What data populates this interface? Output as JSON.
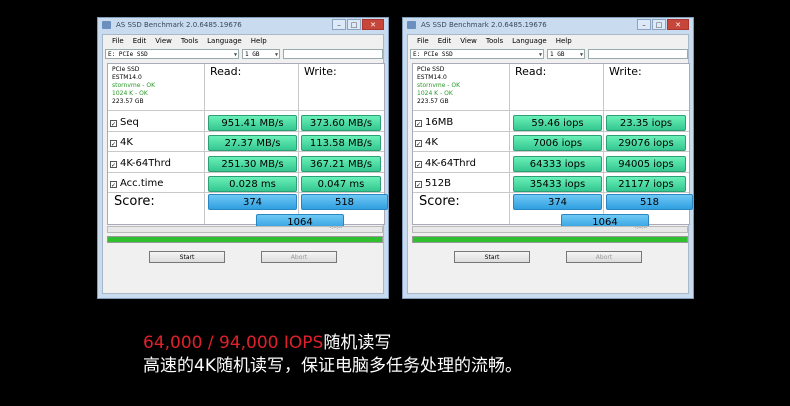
{
  "windows": [
    {
      "title": "AS SSD Benchmark 2.0.6485.19676",
      "menu": [
        "File",
        "Edit",
        "View",
        "Tools",
        "Language",
        "Help"
      ],
      "drive_select": "E: PCIe SSD",
      "size_select": "1 GB",
      "drive_info": {
        "name": "PCIe SSD",
        "firmware": "ESTM14.0",
        "driver": "stornvme - OK",
        "alignment": "1024 K - OK",
        "capacity": "223.57 GB"
      },
      "read_header": "Read:",
      "write_header": "Write:",
      "rows": [
        {
          "label": "Seq",
          "read": "951.41 MB/s",
          "write": "373.60 MB/s"
        },
        {
          "label": "4K",
          "read": "27.37 MB/s",
          "write": "113.58 MB/s"
        },
        {
          "label": "4K-64Thrd",
          "read": "251.30 MB/s",
          "write": "367.21 MB/s"
        },
        {
          "label": "Acc.time",
          "read": "0.028 ms",
          "write": "0.047 ms"
        }
      ],
      "score_label": "Score:",
      "score_read": "374",
      "score_write": "518",
      "score_total": "1064",
      "timer": "-:--:--",
      "progress": 1.0,
      "start_label": "Start",
      "abort_label": "Abort"
    },
    {
      "title": "AS SSD Benchmark 2.0.6485.19676",
      "menu": [
        "File",
        "Edit",
        "View",
        "Tools",
        "Language",
        "Help"
      ],
      "drive_select": "E: PCIe SSD",
      "size_select": "1 GB",
      "drive_info": {
        "name": "PCIe SSD",
        "firmware": "ESTM14.0",
        "driver": "stornvme - OK",
        "alignment": "1024 K - OK",
        "capacity": "223.57 GB"
      },
      "read_header": "Read:",
      "write_header": "Write:",
      "rows": [
        {
          "label": "16MB",
          "read": "59.46 iops",
          "write": "23.35 iops"
        },
        {
          "label": "4K",
          "read": "7006 iops",
          "write": "29076 iops"
        },
        {
          "label": "4K-64Thrd",
          "read": "64333 iops",
          "write": "94005 iops"
        },
        {
          "label": "512B",
          "read": "35433 iops",
          "write": "21177 iops"
        }
      ],
      "score_label": "Score:",
      "score_read": "374",
      "score_write": "518",
      "score_total": "1064",
      "timer": "-:--:--",
      "progress": 1.0,
      "start_label": "Start",
      "abort_label": "Abort"
    }
  ],
  "caption": {
    "highlight": "64,000 / 94,000 IOPS",
    "line1_rest": "随机读写",
    "line2": "高速的4K随机读写，保证电脑多任务处理的流畅。"
  },
  "colors": {
    "value_cell": "#4ddaa4",
    "score_cell": "#45b4ec",
    "highlight": "#e0202a",
    "progress": "#2fbf2f"
  }
}
